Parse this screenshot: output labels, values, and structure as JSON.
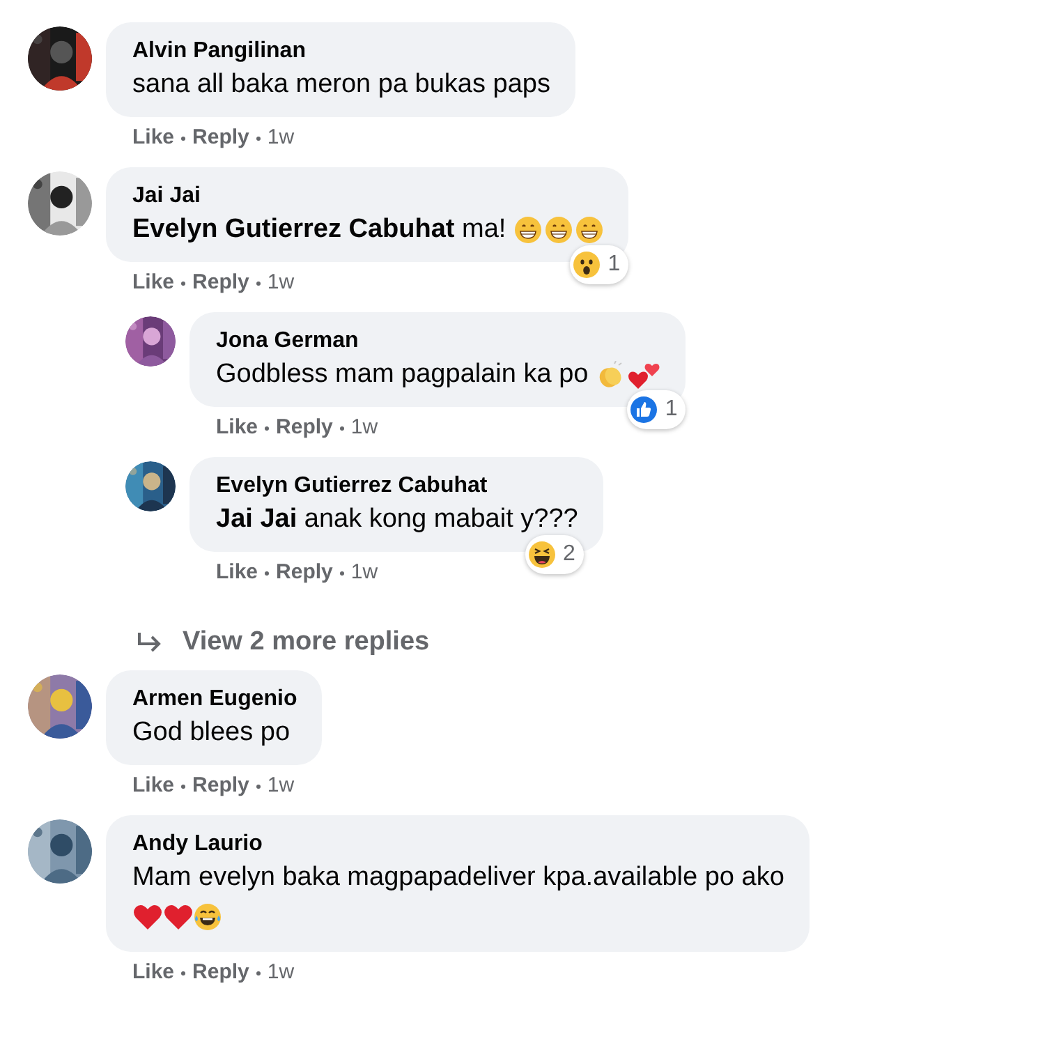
{
  "thread": [
    {
      "kind": "comment",
      "author": "Alvin Pangilinan",
      "text": "sana all baka meron pa bukas paps",
      "actions": [
        "Like",
        "Reply"
      ],
      "time": "1w"
    },
    {
      "kind": "comment",
      "author": "Jai Jai",
      "text": "**Evelyn Gutierrez Cabuhat** ma!",
      "reaction_count": "1",
      "actions": [
        "Like",
        "Reply"
      ],
      "time": "1w"
    },
    {
      "kind": "reply",
      "author": "Jona German",
      "text": "Godbless mam pagpalain ka po",
      "reaction_count": "1",
      "actions": [
        "Like",
        "Reply"
      ],
      "time": "1w"
    },
    {
      "kind": "reply",
      "author": "Evelyn Gutierrez Cabuhat",
      "text": "**Jai Jai** anak kong mabait y???",
      "reaction_count": "2",
      "actions": [
        "Like",
        "Reply"
      ],
      "time": "1w"
    },
    {
      "kind": "more",
      "label": "View 2 more replies"
    },
    {
      "kind": "comment",
      "author": "Armen Eugenio",
      "text": "God blees po",
      "actions": [
        "Like",
        "Reply"
      ],
      "time": "1w"
    },
    {
      "kind": "comment",
      "author": "Andy Laurio",
      "text": "Mam evelyn baka magpapadeliver kpa.available po ako",
      "actions": [
        "Like",
        "Reply"
      ],
      "time": "1w"
    }
  ]
}
